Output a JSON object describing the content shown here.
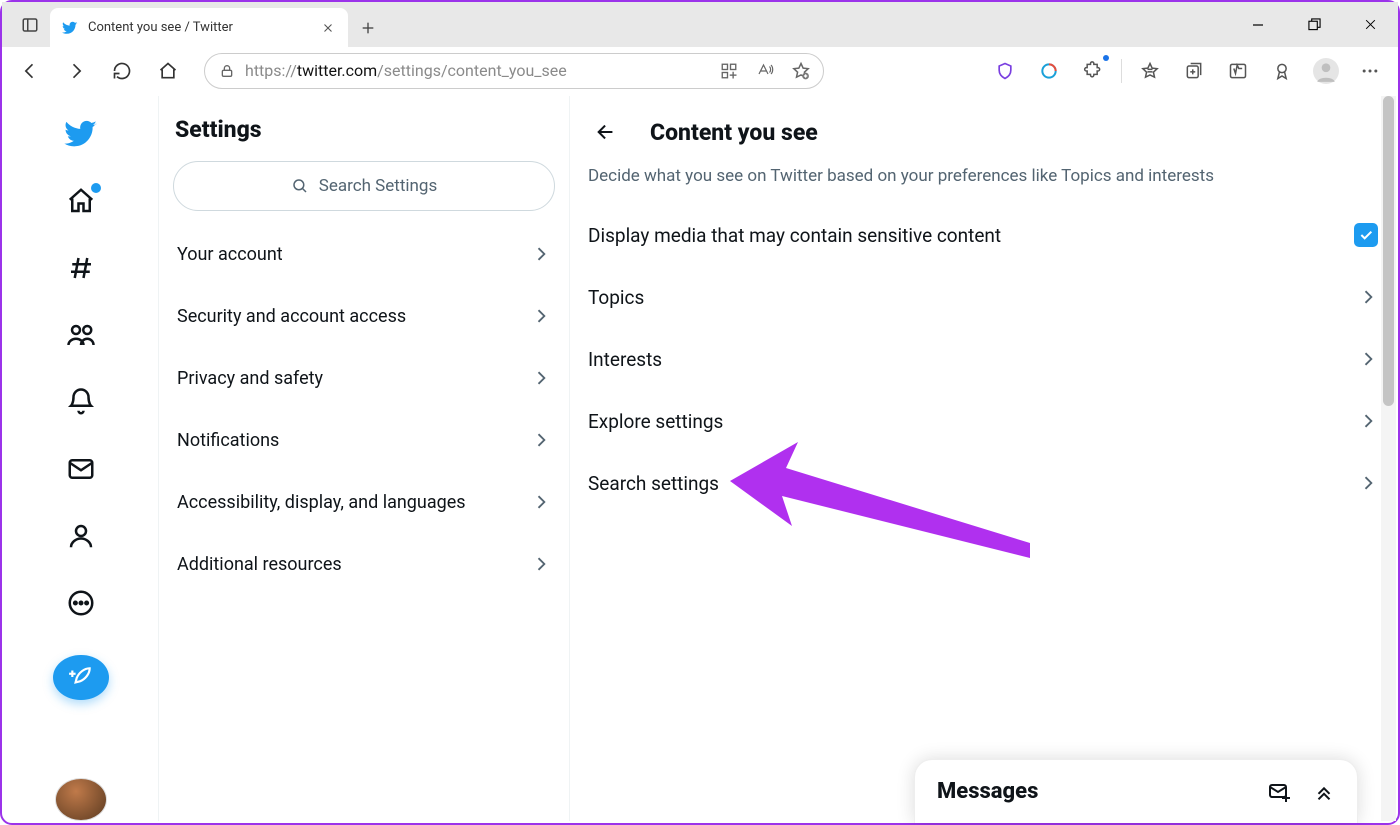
{
  "window": {
    "tab_title": "Content you see / Twitter",
    "url_scheme": "https://",
    "url_host": "twitter.com",
    "url_path": "/settings/content_you_see"
  },
  "settings_panel": {
    "title": "Settings",
    "search_placeholder": "Search Settings",
    "items": [
      "Your account",
      "Security and account access",
      "Privacy and safety",
      "Notifications",
      "Accessibility, display, and languages",
      "Additional resources"
    ]
  },
  "detail_panel": {
    "title": "Content you see",
    "subtitle": "Decide what you see on Twitter based on your preferences like Topics and interests",
    "sensitive_toggle": {
      "label": "Display media that may contain sensitive content",
      "checked": true
    },
    "rows": [
      "Topics",
      "Interests",
      "Explore settings",
      "Search settings"
    ]
  },
  "messages_drawer": {
    "title": "Messages"
  },
  "colors": {
    "accent": "#1d9bf0",
    "text": "#0f1419",
    "muted": "#536471",
    "annotation": "#b030ef"
  }
}
